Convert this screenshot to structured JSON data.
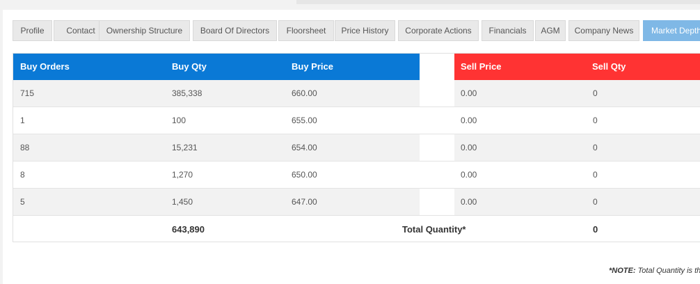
{
  "tabs": [
    {
      "label": "Profile",
      "active": false
    },
    {
      "label": "Contact",
      "active": false
    },
    {
      "label": "Ownership Structure",
      "active": false
    },
    {
      "label": "Board Of Directors",
      "active": false
    },
    {
      "label": "Floorsheet",
      "active": false
    },
    {
      "label": "Price History",
      "active": false
    },
    {
      "label": "Corporate Actions",
      "active": false
    },
    {
      "label": "Financials",
      "active": false
    },
    {
      "label": "AGM",
      "active": false
    },
    {
      "label": "Company News",
      "active": false
    },
    {
      "label": "Market Depth",
      "active": true
    }
  ],
  "table": {
    "headers": {
      "buy_orders": "Buy Orders",
      "buy_qty": "Buy Qty",
      "buy_price": "Buy Price",
      "sell_price": "Sell Price",
      "sell_qty": "Sell Qty"
    },
    "rows": [
      {
        "buy_orders": "715",
        "buy_qty": "385,338",
        "buy_price": "660.00",
        "sell_price": "0.00",
        "sell_qty": "0"
      },
      {
        "buy_orders": "1",
        "buy_qty": "100",
        "buy_price": "655.00",
        "sell_price": "0.00",
        "sell_qty": "0"
      },
      {
        "buy_orders": "88",
        "buy_qty": "15,231",
        "buy_price": "654.00",
        "sell_price": "0.00",
        "sell_qty": "0"
      },
      {
        "buy_orders": "8",
        "buy_qty": "1,270",
        "buy_price": "650.00",
        "sell_price": "0.00",
        "sell_qty": "0"
      },
      {
        "buy_orders": "5",
        "buy_qty": "1,450",
        "buy_price": "647.00",
        "sell_price": "0.00",
        "sell_qty": "0"
      }
    ],
    "total": {
      "buy_total": "643,890",
      "label": "Total Quantity*",
      "sell_total": "0"
    }
  },
  "note": {
    "prefix": "*NOTE:",
    "text": "Total Quantity is th"
  },
  "colors": {
    "buy_header": "#0a79d6",
    "sell_header": "#ff3333",
    "active_tab": "#7fb8e6"
  }
}
